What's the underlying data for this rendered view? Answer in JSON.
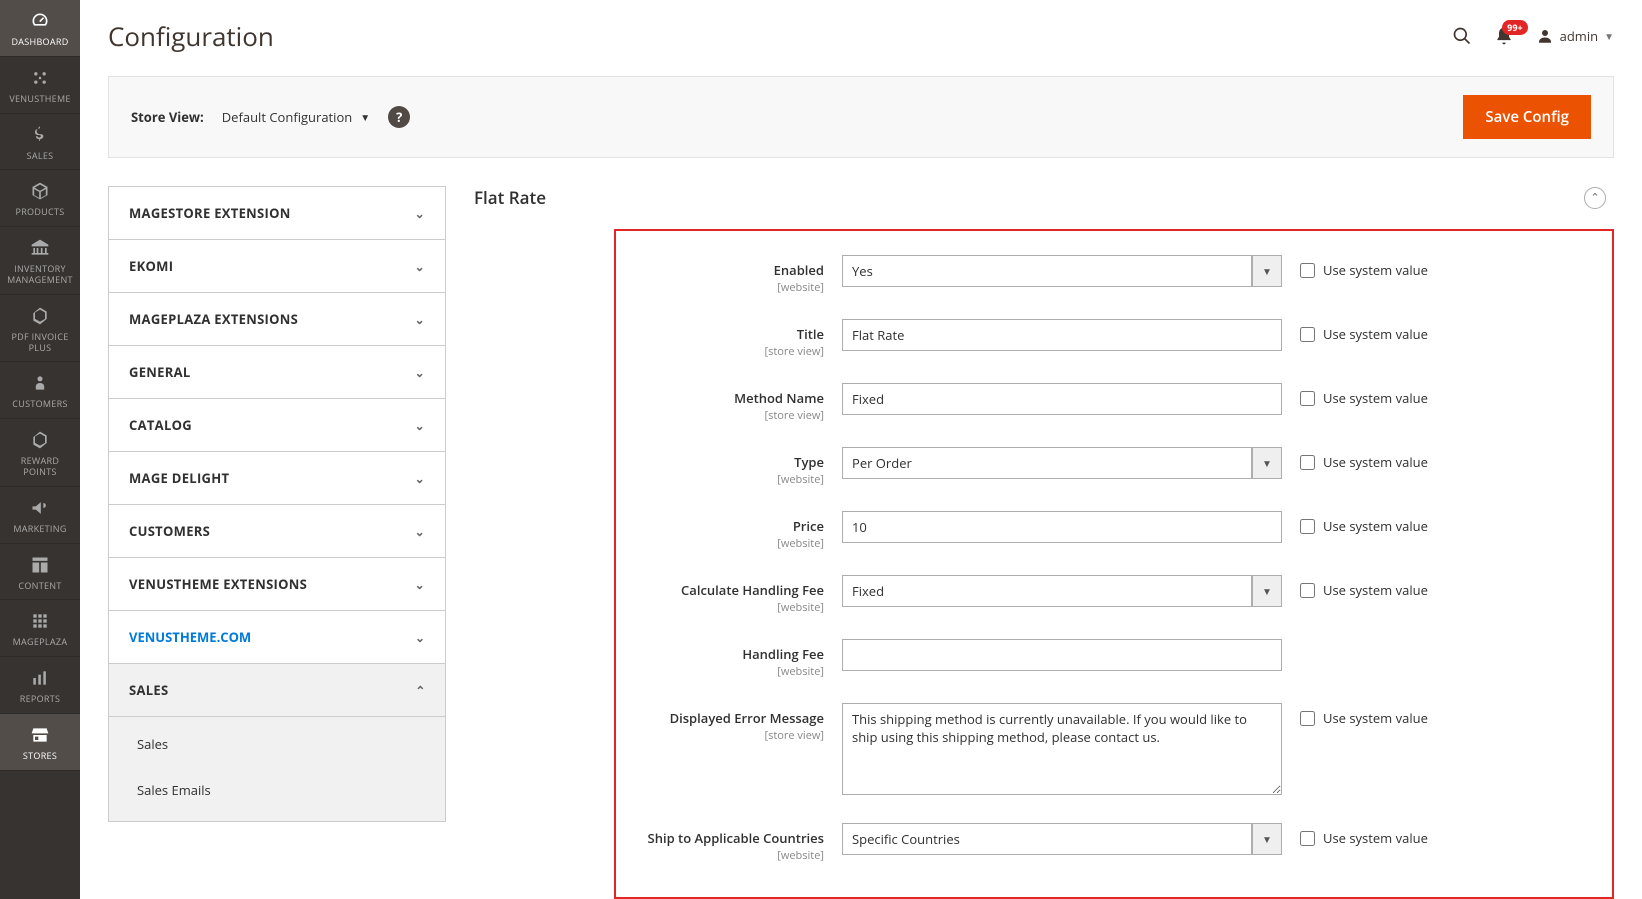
{
  "page": {
    "title": "Configuration"
  },
  "header": {
    "notif_count": "99+",
    "username": "admin"
  },
  "toolbar": {
    "scope_label": "Store View:",
    "scope_value": "Default Configuration",
    "save_label": "Save Config"
  },
  "sidebar": {
    "items": [
      {
        "label": "DASHBOARD",
        "icon": "gauge"
      },
      {
        "label": "VENUSTHEME",
        "icon": "sparkle"
      },
      {
        "label": "SALES",
        "icon": "dollar"
      },
      {
        "label": "PRODUCTS",
        "icon": "box"
      },
      {
        "label": "INVENTORY MANAGEMENT",
        "icon": "bank"
      },
      {
        "label": "PDF INVOICE PLUS",
        "icon": "hex"
      },
      {
        "label": "CUSTOMERS",
        "icon": "person"
      },
      {
        "label": "REWARD POINTS",
        "icon": "hex"
      },
      {
        "label": "MARKETING",
        "icon": "megaphone"
      },
      {
        "label": "CONTENT",
        "icon": "layout"
      },
      {
        "label": "MAGEPLAZA",
        "icon": "grid"
      },
      {
        "label": "REPORTS",
        "icon": "bars"
      },
      {
        "label": "STORES",
        "icon": "store"
      }
    ]
  },
  "config_nav": {
    "sections": [
      {
        "label": "MAGESTORE EXTENSION"
      },
      {
        "label": "EKOMI"
      },
      {
        "label": "MAGEPLAZA EXTENSIONS"
      },
      {
        "label": "GENERAL"
      },
      {
        "label": "CATALOG"
      },
      {
        "label": "MAGE DELIGHT"
      },
      {
        "label": "CUSTOMERS"
      },
      {
        "label": "VENUSTHEME EXTENSIONS"
      },
      {
        "label": "VENUSTHEME.COM"
      },
      {
        "label": "SALES"
      }
    ],
    "sub_items": [
      {
        "label": "Sales"
      },
      {
        "label": "Sales Emails"
      }
    ]
  },
  "section": {
    "title": "Flat Rate"
  },
  "form": {
    "sys_label": "Use system value",
    "fields": {
      "enabled": {
        "label": "Enabled",
        "scope": "[website]",
        "value": "Yes",
        "type": "select"
      },
      "title": {
        "label": "Title",
        "scope": "[store view]",
        "value": "Flat Rate",
        "type": "text"
      },
      "method": {
        "label": "Method Name",
        "scope": "[store view]",
        "value": "Fixed",
        "type": "text"
      },
      "type": {
        "label": "Type",
        "scope": "[website]",
        "value": "Per Order",
        "type": "select"
      },
      "price": {
        "label": "Price",
        "scope": "[website]",
        "value": "10",
        "type": "text"
      },
      "handling": {
        "label": "Calculate Handling Fee",
        "scope": "[website]",
        "value": "Fixed",
        "type": "select"
      },
      "handling_fee": {
        "label": "Handling Fee",
        "scope": "[website]",
        "value": "",
        "type": "text"
      },
      "error": {
        "label": "Displayed Error Message",
        "scope": "[store view]",
        "value": "This shipping method is currently unavailable. If you would like to ship using this shipping method, please contact us.",
        "type": "textarea"
      },
      "countries": {
        "label": "Ship to Applicable Countries",
        "scope": "[website]",
        "value": "Specific Countries",
        "type": "select"
      }
    }
  }
}
